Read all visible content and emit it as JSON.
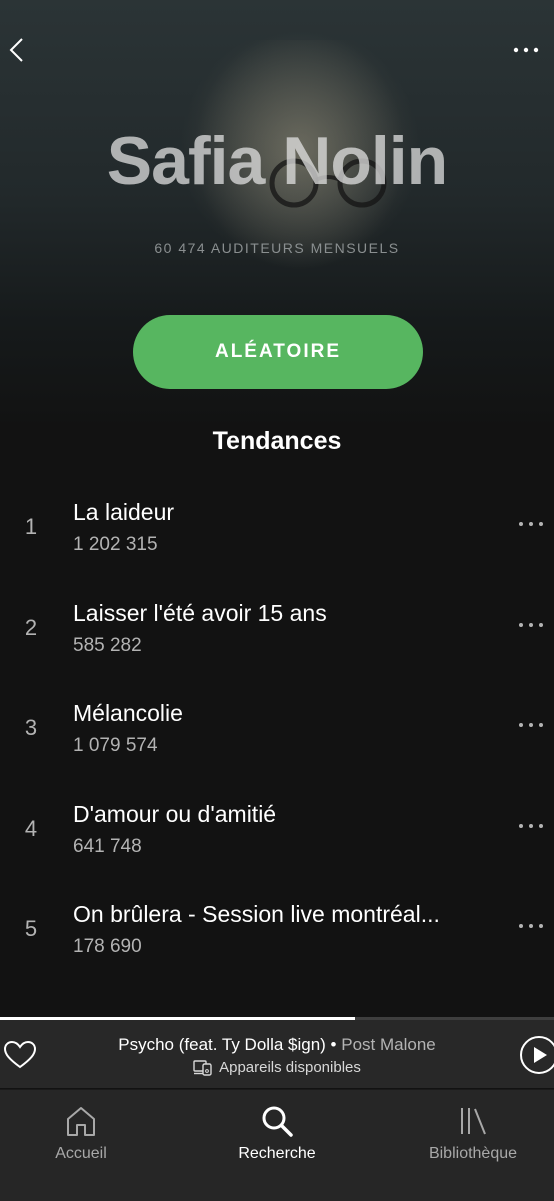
{
  "artist": {
    "name": "Safia Nolin",
    "monthly_listeners": "60 474 AUDITEURS MENSUELS"
  },
  "actions": {
    "shuffle_label": "ALÉATOIRE"
  },
  "section": {
    "title": "Tendances"
  },
  "tracks": [
    {
      "rank": "1",
      "title": "La laideur",
      "plays": "1 202 315"
    },
    {
      "rank": "2",
      "title": "Laisser l'été avoir 15 ans",
      "plays": "585 282"
    },
    {
      "rank": "3",
      "title": "Mélancolie",
      "plays": "1 079 574"
    },
    {
      "rank": "4",
      "title": "D'amour ou d'amitié",
      "plays": "641 748"
    },
    {
      "rank": "5",
      "title": "On brûlera - Session live montréal...",
      "plays": "178 690"
    }
  ],
  "now_playing": {
    "title": "Psycho (feat. Ty Dolla $ign)",
    "separator": " • ",
    "artist": "Post Malone",
    "devices_label": "Appareils disponibles",
    "progress": 0.64
  },
  "nav": {
    "home": "Accueil",
    "search": "Recherche",
    "library": "Bibliothèque"
  },
  "colors": {
    "accent_green": "#57b660",
    "background": "#121212",
    "player_bg": "#282828"
  },
  "icons": [
    "back-chevron-icon",
    "more-options-icon",
    "heart-icon",
    "devices-icon",
    "play-icon",
    "home-icon",
    "search-icon",
    "library-icon"
  ]
}
